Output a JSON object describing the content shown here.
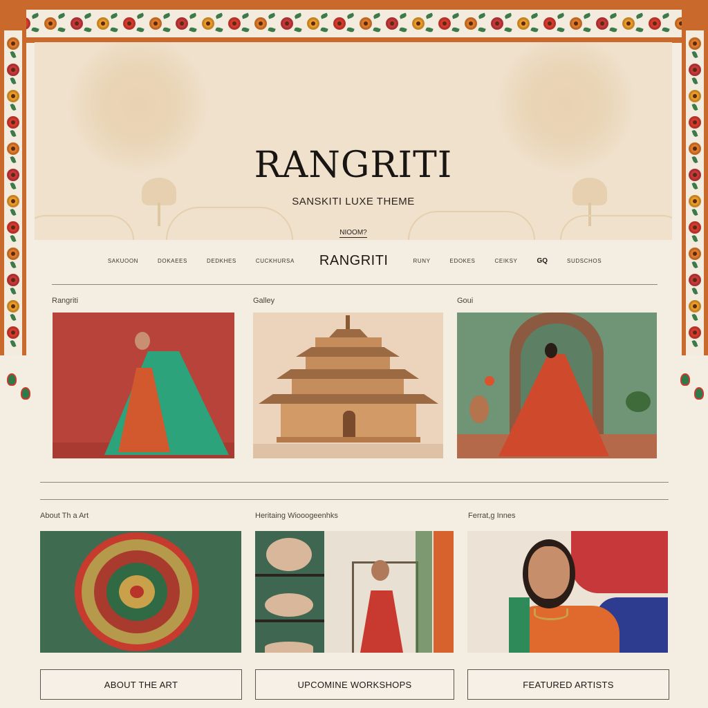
{
  "hero": {
    "title": "RANGRITI",
    "subtitle": "SANSKITI LUXE THEME",
    "link": "NIOOM?"
  },
  "nav": {
    "items_left": [
      "SAKUOON",
      "DOKAEES",
      "DEDKHES",
      "CUCKHURSA"
    ],
    "brand": "RANGRITI",
    "items_right": [
      "RUNY",
      "EDOKES",
      "CEIKSY"
    ],
    "search": "GQ",
    "last": "SUDSCHOS"
  },
  "gallery": {
    "labels": [
      "Rangriti",
      "Galley",
      "Goui"
    ]
  },
  "features": {
    "labels": [
      "About Th a Art",
      "Heritaing Wiooogeenhks",
      "Ferrat,g Innes"
    ],
    "buttons": [
      "ABOUT THE ART",
      "UPCOMINE WORKSHOPS",
      "FEATURED ARTISTS"
    ]
  },
  "colors": {
    "frame_orange": "#c9692b",
    "hero_cream": "#efe1cc",
    "page_bg": "#f4ede2",
    "card_red": "#b8433a",
    "card_green": "#3f6b50"
  },
  "icons": [
    "flower-icon",
    "leaf-icon",
    "tassel-icon",
    "search-icon"
  ]
}
